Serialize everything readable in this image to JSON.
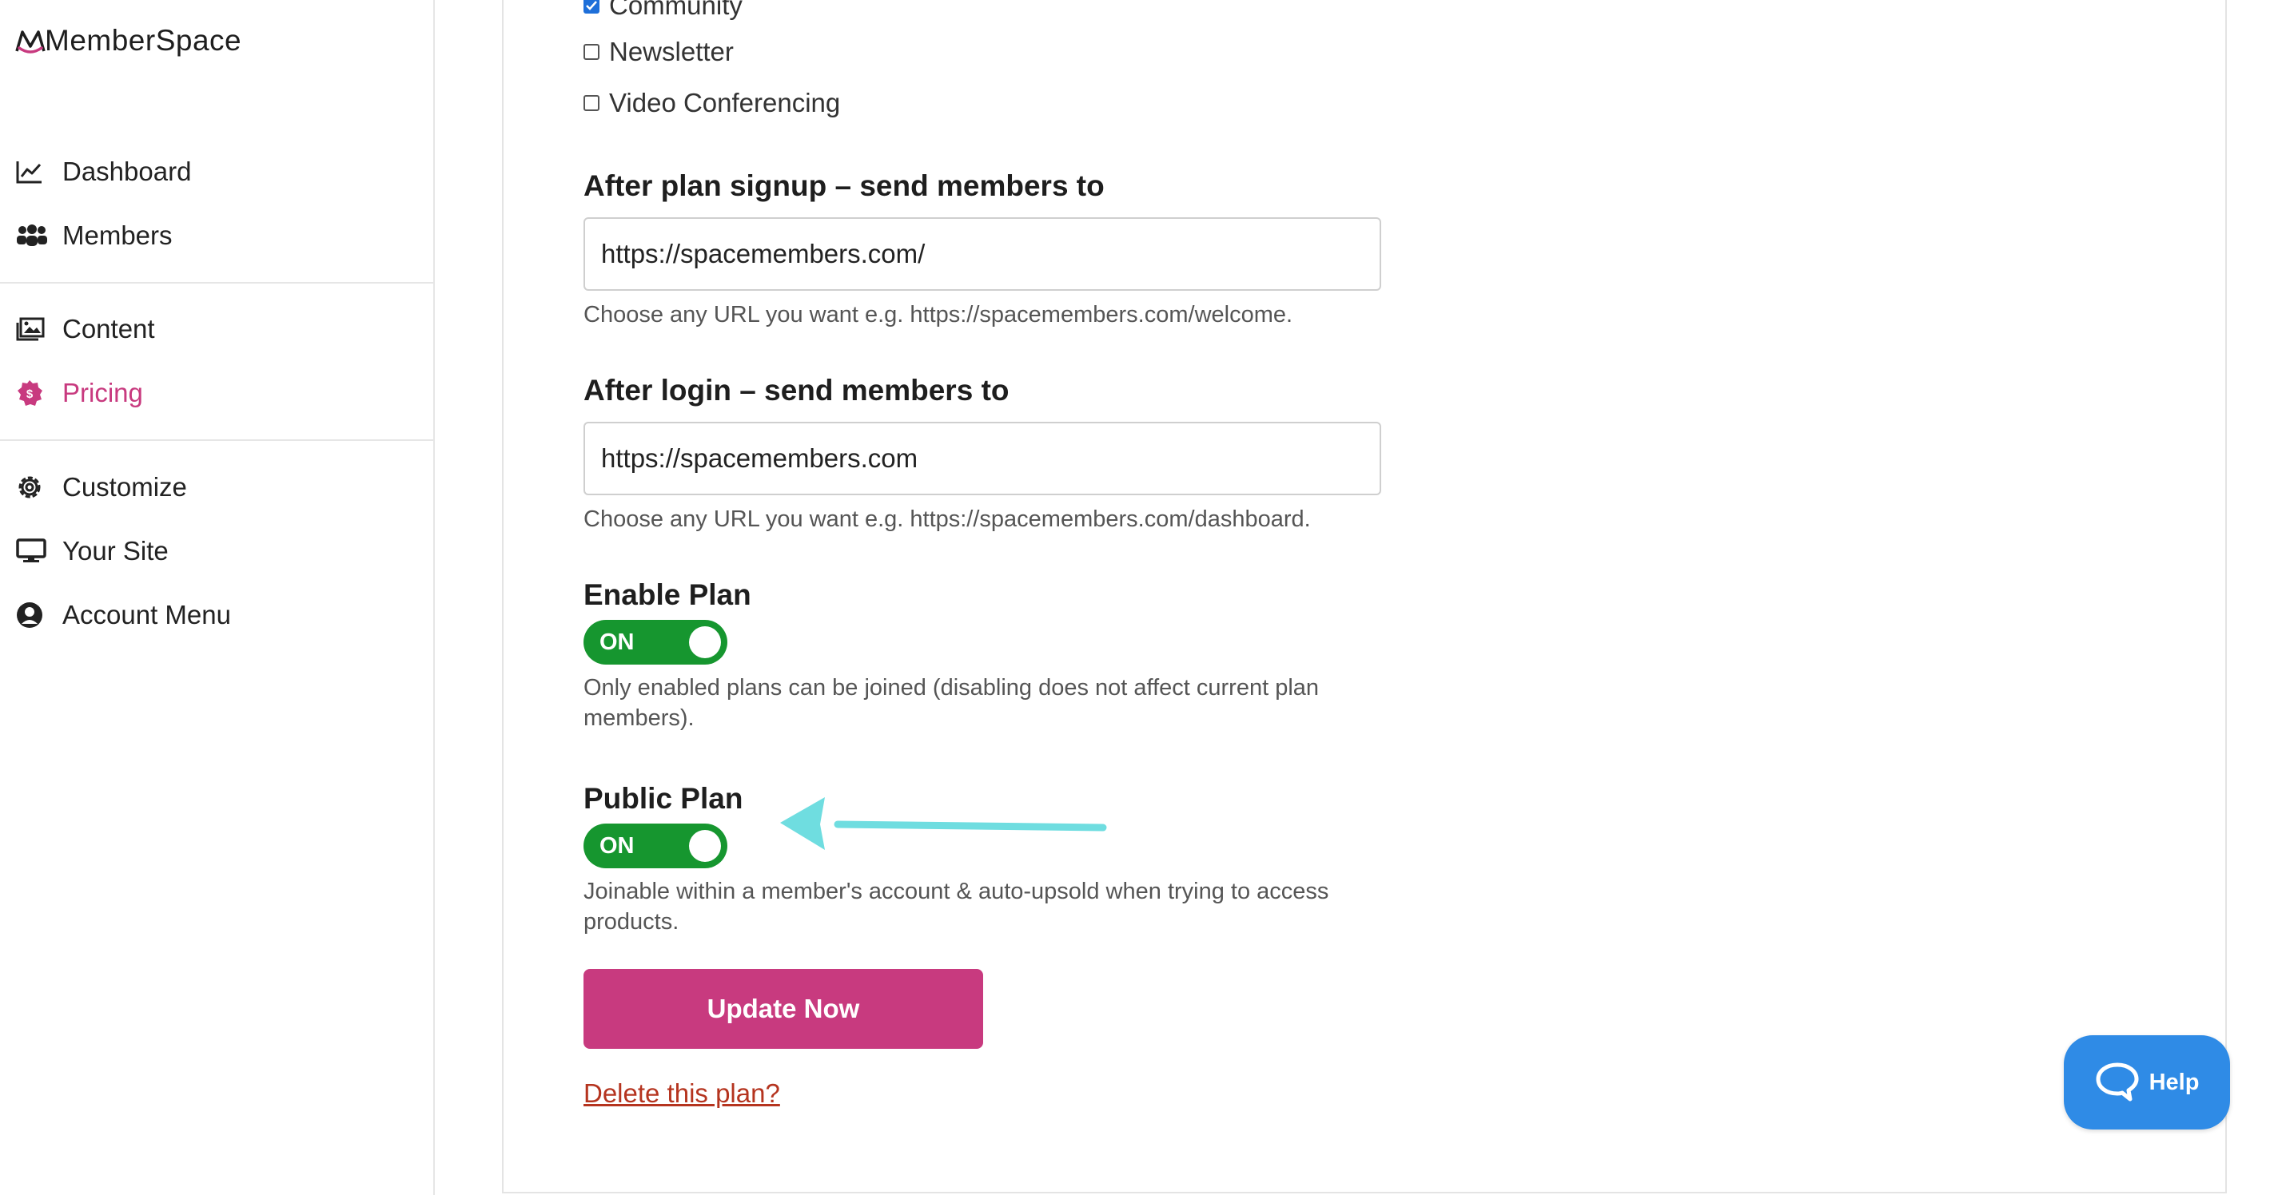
{
  "app": {
    "name": "MemberSpace"
  },
  "sidebar": {
    "items": [
      {
        "label": "Dashboard",
        "icon": "chart-line-icon"
      },
      {
        "label": "Members",
        "icon": "users-icon"
      },
      {
        "label": "Content",
        "icon": "image-icon"
      },
      {
        "label": "Pricing",
        "icon": "dollar-badge-icon",
        "active": true
      },
      {
        "label": "Customize",
        "icon": "gear-icon"
      },
      {
        "label": "Your Site",
        "icon": "monitor-icon"
      },
      {
        "label": "Account Menu",
        "icon": "user-circle-icon"
      }
    ]
  },
  "form": {
    "checkboxes": [
      {
        "label": "Community",
        "checked": true
      },
      {
        "label": "Newsletter",
        "checked": false
      },
      {
        "label": "Video Conferencing",
        "checked": false
      }
    ],
    "after_signup": {
      "label": "After plan signup – send members to",
      "value": "https://spacemembers.com/",
      "hint": "Choose any URL you want e.g. https://spacemembers.com/welcome."
    },
    "after_login": {
      "label": "After login – send members to",
      "value": "https://spacemembers.com",
      "hint": "Choose any URL you want e.g. https://spacemembers.com/dashboard."
    },
    "enable_plan": {
      "label": "Enable Plan",
      "state": "ON",
      "hint": "Only enabled plans can be joined (disabling does not affect current plan members)."
    },
    "public_plan": {
      "label": "Public Plan",
      "state": "ON",
      "hint": "Joinable within a member's account & auto-upsold when trying to access products."
    },
    "update_button": "Update Now",
    "delete_link": "Delete this plan?"
  },
  "help": {
    "label": "Help"
  },
  "colors": {
    "accent": "#c83a7f",
    "toggle_on": "#16962f",
    "help": "#2f8be6",
    "delete": "#b5341f",
    "arrow": "#6fdde0"
  }
}
